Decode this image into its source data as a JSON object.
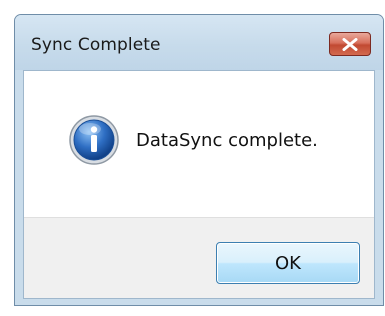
{
  "window": {
    "title": "Sync Complete",
    "close_icon": "close-x-icon"
  },
  "message": {
    "icon": "info-icon",
    "text": "DataSync complete."
  },
  "buttons": {
    "ok_label": "OK"
  },
  "colors": {
    "titlebar": "#c7dbeb",
    "close_button": "#c14a32",
    "info_icon": "#2f6fc4",
    "ok_button_border": "#3c7fb1",
    "button_area": "#f0f0f0"
  }
}
